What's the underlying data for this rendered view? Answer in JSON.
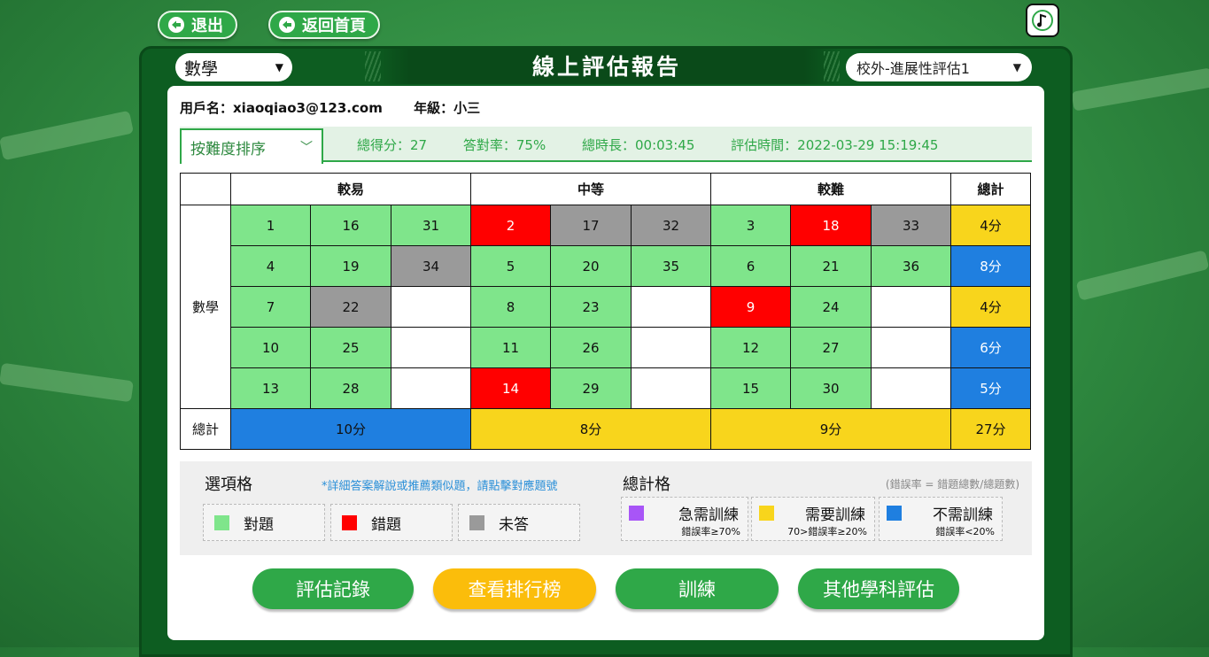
{
  "top": {
    "logout": "退出",
    "home": "返回首頁"
  },
  "header": {
    "subject": "數學",
    "title": "線上評估報告",
    "evaluation": "校外-進展性評估1"
  },
  "user": {
    "name": "用戶名：xiaoqiao3@123.com",
    "grade": "年級：小三"
  },
  "sort": {
    "label": "按難度排序"
  },
  "stats": {
    "score": "總得分：27",
    "accuracy": "答對率：75%",
    "duration": "總時長：00:03:45",
    "time": "評估時間：2022-03-29 15:19:45"
  },
  "table": {
    "headers": [
      "較易",
      "中等",
      "較難",
      "總計"
    ],
    "subject": "數學",
    "total_label": "總計",
    "rows": [
      {
        "cells": [
          "1",
          "16",
          "31",
          "2",
          "17",
          "32",
          "3",
          "18",
          "33"
        ],
        "status": [
          "g",
          "g",
          "g",
          "r",
          "x",
          "x",
          "g",
          "r",
          "x"
        ],
        "total": "4分",
        "total_status": "y"
      },
      {
        "cells": [
          "4",
          "19",
          "34",
          "5",
          "20",
          "35",
          "6",
          "21",
          "36"
        ],
        "status": [
          "g",
          "g",
          "x",
          "g",
          "g",
          "g",
          "g",
          "g",
          "g"
        ],
        "total": "8分",
        "total_status": "b"
      },
      {
        "cells": [
          "7",
          "22",
          "",
          "8",
          "23",
          "",
          "9",
          "24",
          ""
        ],
        "status": [
          "g",
          "x",
          "w",
          "g",
          "g",
          "w",
          "r",
          "g",
          "w"
        ],
        "total": "4分",
        "total_status": "y"
      },
      {
        "cells": [
          "10",
          "25",
          "",
          "11",
          "26",
          "",
          "12",
          "27",
          ""
        ],
        "status": [
          "g",
          "g",
          "w",
          "g",
          "g",
          "w",
          "g",
          "g",
          "w"
        ],
        "total": "6分",
        "total_status": "b"
      },
      {
        "cells": [
          "13",
          "28",
          "",
          "14",
          "29",
          "",
          "15",
          "30",
          ""
        ],
        "status": [
          "g",
          "g",
          "w",
          "r",
          "g",
          "w",
          "g",
          "g",
          "w"
        ],
        "total": "5分",
        "total_status": "b"
      }
    ],
    "totals": [
      "10分",
      "8分",
      "9分",
      "27分"
    ],
    "totals_status": [
      "b",
      "y",
      "y",
      "y"
    ]
  },
  "legend": {
    "option_title": "選項格",
    "option_note": "*詳細答案解說或推薦類似題，請點擊對應題號",
    "correct": "對題",
    "wrong": "錯題",
    "unanswered": "未答",
    "total_title": "總計格",
    "total_note": "(錯誤率 = 錯題總數/總題數)",
    "urgent": "急需訓練",
    "urgent_sub": "錯誤率≥70%",
    "need": "需要訓練",
    "need_sub": "70>錯誤率≥20%",
    "noneed": "不需訓練",
    "noneed_sub": "錯誤率<20%"
  },
  "colors": {
    "correct": "#7fe58b",
    "wrong": "#ff0000",
    "unanswered": "#9a9a9a",
    "urgent": "#a855f7",
    "need": "#f8d51c",
    "noneed": "#1f7fe0"
  },
  "buttons": {
    "records": "評估記錄",
    "ranking": "查看排行榜",
    "train": "訓練",
    "other": "其他學科評估"
  }
}
